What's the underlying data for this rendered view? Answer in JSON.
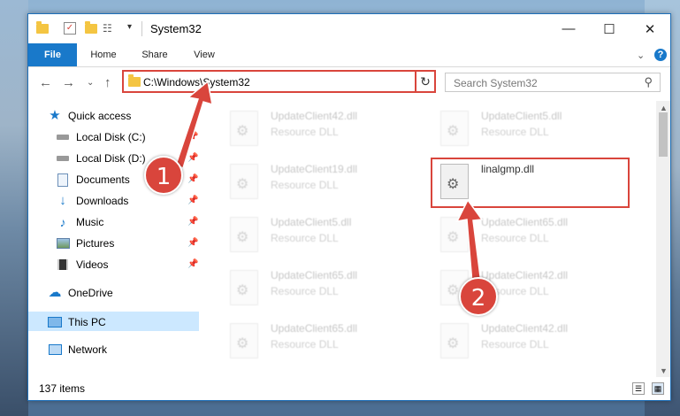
{
  "window": {
    "title": "System32",
    "controls": [
      "—",
      "☐",
      "✕"
    ]
  },
  "ribbon": {
    "tabs": [
      "File",
      "Home",
      "Share",
      "View"
    ],
    "help": "?"
  },
  "address": {
    "path": "C:\\Windows\\System32",
    "search_placeholder": "Search System32"
  },
  "nav": {
    "quick_access": "Quick access",
    "items": [
      {
        "label": "Local Disk (C:)",
        "icon": "drive-icon"
      },
      {
        "label": "Local Disk (D:)",
        "icon": "drive-icon"
      },
      {
        "label": "Documents",
        "icon": "documents-icon"
      },
      {
        "label": "Downloads",
        "icon": "download-icon"
      },
      {
        "label": "Music",
        "icon": "music-icon"
      },
      {
        "label": "Pictures",
        "icon": "pictures-icon"
      },
      {
        "label": "Videos",
        "icon": "videos-icon"
      }
    ],
    "onedrive": "OneDrive",
    "this_pc": "This PC",
    "network": "Network"
  },
  "files": [
    {
      "name": "UpdateClient42.dll",
      "type": "Resource DLL"
    },
    {
      "name": "UpdateClient5.dll",
      "type": "Resource DLL"
    },
    {
      "name": "UpdateClient19.dll",
      "type": "Resource DLL"
    },
    {
      "name": "linalgmp.dll",
      "type": ""
    },
    {
      "name": "UpdateClient5.dll",
      "type": "Resource DLL"
    },
    {
      "name": "UpdateClient65.dll",
      "type": "Resource DLL"
    },
    {
      "name": "UpdateClient65.dll",
      "type": "Resource DLL"
    },
    {
      "name": "UpdateClient42.dll",
      "type": "Resource DLL"
    },
    {
      "name": "UpdateClient65.dll",
      "type": "Resource DLL"
    },
    {
      "name": "UpdateClient42.dll",
      "type": "Resource DLL"
    }
  ],
  "status": {
    "items_count": "137 items"
  },
  "annotations": {
    "step1": "1",
    "step2": "2",
    "color": "#d9453c"
  }
}
